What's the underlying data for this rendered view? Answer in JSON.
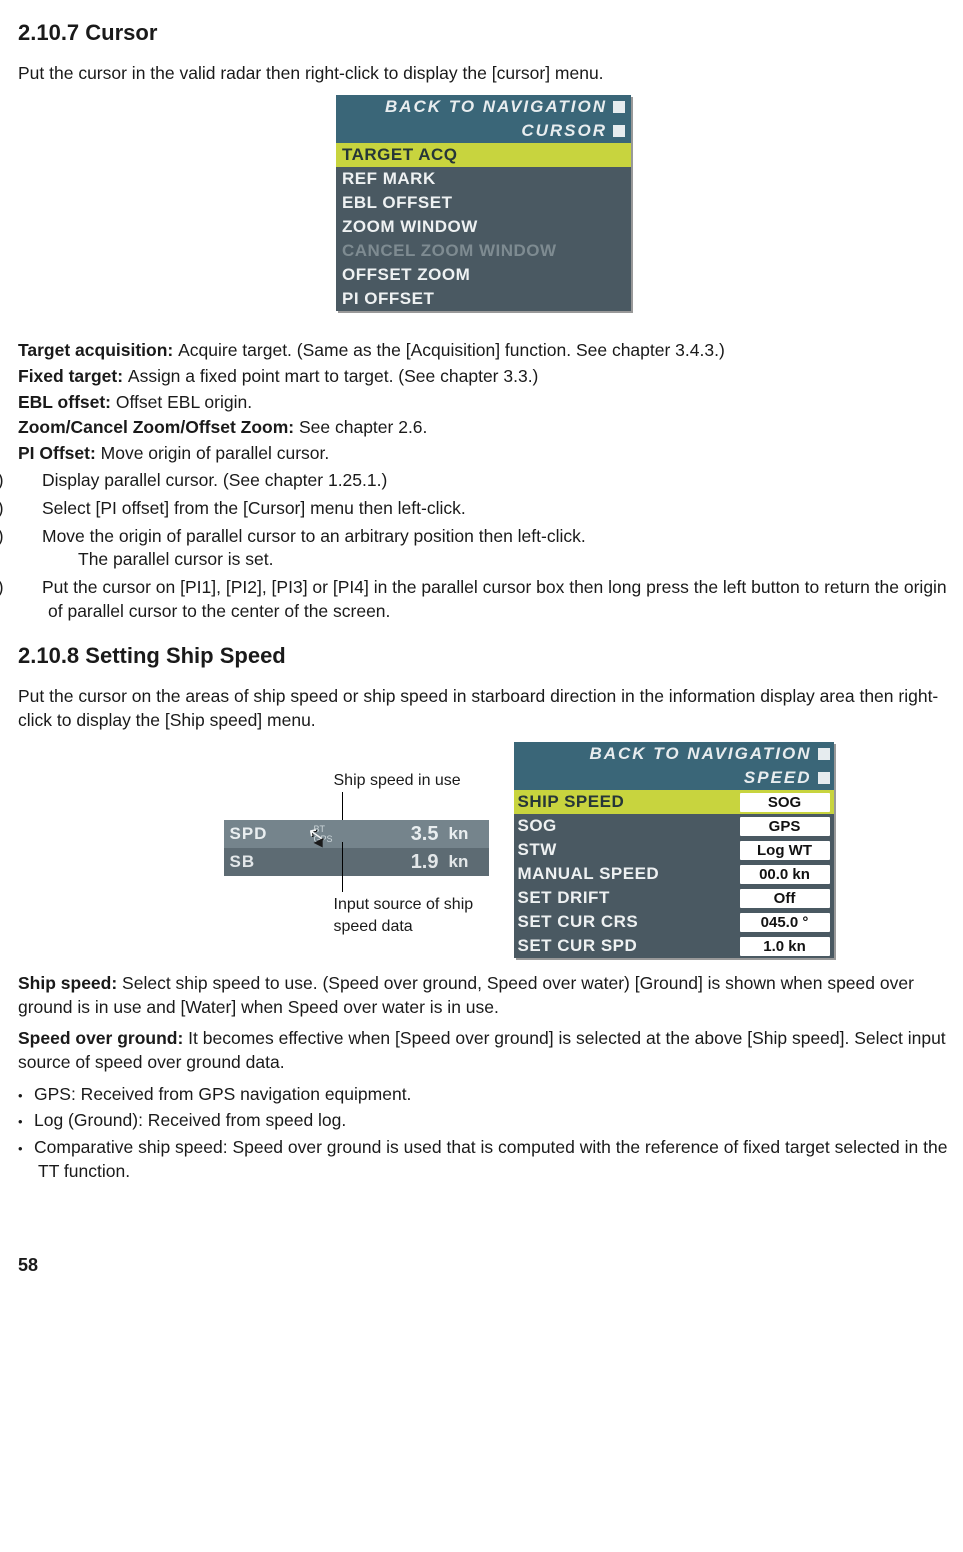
{
  "s1": {
    "heading": "2.10.7 Cursor",
    "intro": "Put the cursor in the valid radar then right-click to display the [cursor] menu.",
    "menu": {
      "back": "BACK TO NAVIGATION",
      "title": "CURSOR",
      "target_acq": "TARGET ACQ",
      "ref_mark": "REF MARK",
      "ebl_offset": "EBL OFFSET",
      "zoom_window": "ZOOM WINDOW",
      "cancel_zoom": "CANCEL ZOOM WINDOW",
      "offset_zoom": "OFFSET ZOOM",
      "pi_offset": "PI OFFSET"
    },
    "defs": {
      "target_acq_l": "Target acquisition: ",
      "target_acq_t": "Acquire target. (Same as the [Acquisition] function. See chapter 3.4.3.)",
      "fixed_l": "Fixed target:  ",
      "fixed_t": "Assign a fixed point mart to target. (See chapter 3.3.)",
      "ebl_l": "EBL offset: ",
      "ebl_t": "Offset EBL origin.",
      "zoom_l": "Zoom/Cancel Zoom/Offset Zoom: ",
      "zoom_t": "See chapter 2.6.",
      "pi_l": "PI Offset: ",
      "pi_t": "Move origin of parallel cursor."
    },
    "list": {
      "n1": "Display parallel cursor. (See chapter 1.25.1.)",
      "n2": "Select [PI offset] from the [Cursor] menu then left-click.",
      "n3a": "Move the origin of parallel cursor to an arbitrary position then left-click.",
      "n3b": "The parallel cursor is set.",
      "n4": "Put the cursor on [PI1], [PI2], [PI3] or [PI4] in the parallel cursor box  then long press the left button to return the origin of parallel cursor to the center of the screen."
    }
  },
  "s2": {
    "heading": "2.10.8 Setting Ship Speed",
    "intro": "Put the cursor on the areas of ship speed or ship speed in starboard direction in the information display area then right-click to display the [Ship speed] menu.",
    "callout_top": "Ship speed in use",
    "callout_bot": "Input source of ship speed data",
    "spd": {
      "row1": {
        "label": "SPD",
        "mini1": "BT",
        "mini2": "GPS",
        "val": "3.5",
        "unit": "kn"
      },
      "row2": {
        "label": "SB",
        "val": "1.9",
        "unit": "kn"
      }
    },
    "menu": {
      "back": "BACK TO NAVIGATION",
      "title": "SPEED",
      "ship_speed_l": "SHIP SPEED",
      "ship_speed_v": "SOG",
      "sog_l": "SOG",
      "sog_v": "GPS",
      "stw_l": "STW",
      "stw_v": "Log WT",
      "manual_l": "MANUAL SPEED",
      "manual_v": "00.0 kn",
      "drift_l": "SET DRIFT",
      "drift_v": "Off",
      "crs_l": "SET CUR CRS",
      "crs_v": "045.0 °",
      "spd_l": "SET CUR SPD",
      "spd_v": "1.0 kn"
    },
    "defs": {
      "ship_l": "Ship speed:   ",
      "ship_t": "Select ship speed to use. (Speed over ground, Speed over water) [Ground] is shown when speed over ground is in use and [Water] when Speed over water is in use.",
      "sog_l": "Speed over ground: ",
      "sog_t": "It becomes effective when [Speed over ground] is selected at the above [Ship speed]. Select input source of speed over ground data."
    },
    "bullets": {
      "b1": "GPS: Received from GPS navigation equipment.",
      "b2": "Log (Ground): Received from speed log.",
      "b3": "Comparative ship speed: Speed over ground is used that is computed with the  reference of fixed target selected in the TT function."
    }
  },
  "pagefoot": "58"
}
